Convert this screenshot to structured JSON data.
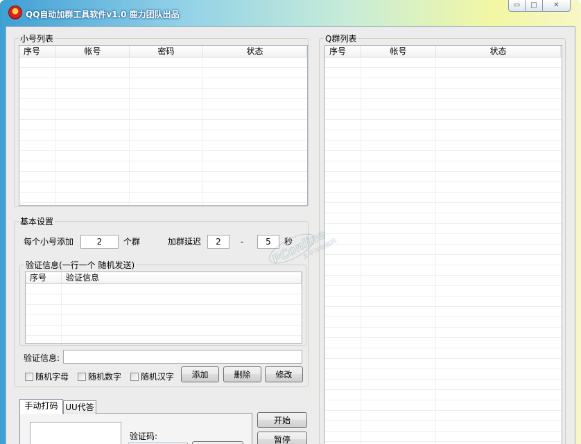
{
  "window": {
    "title": "QQ自动加群工具软件v1.0  鹿力团队出品",
    "minimize_glyph": "▭",
    "maximize_glyph": "□",
    "close_glyph": "✕"
  },
  "account_list": {
    "title": "小号列表",
    "columns": [
      "序号",
      "帐号",
      "密码",
      "状态"
    ]
  },
  "group_list": {
    "title": "Q群列表",
    "columns": [
      "序号",
      "帐号",
      "状态"
    ]
  },
  "basic_settings": {
    "title": "基本设置",
    "per_account_label": "每个小号添加",
    "per_account_value": "2",
    "group_unit": "个群",
    "delay_label": "加群延迟",
    "delay_min": "2",
    "delay_sep": "-",
    "delay_max": "5",
    "seconds_unit": "秒"
  },
  "verify": {
    "title": "验证信息(一行一个 随机发送)",
    "columns": [
      "序号",
      "验证信息"
    ],
    "input_label": "验证信息:",
    "input_value": "",
    "random_letters": "随机字母",
    "random_digits": "随机数字",
    "random_chinese": "随机汉字",
    "add": "添加",
    "delete": "删除",
    "modify": "修改"
  },
  "captcha": {
    "tabs": [
      "手动打码",
      "UU代答"
    ],
    "code_label": "验证码:"
  },
  "actions": {
    "start": "开始",
    "pause": "暂停"
  },
  "watermark": {
    "text": "PConline",
    "sub": "太平洋电脑网"
  }
}
